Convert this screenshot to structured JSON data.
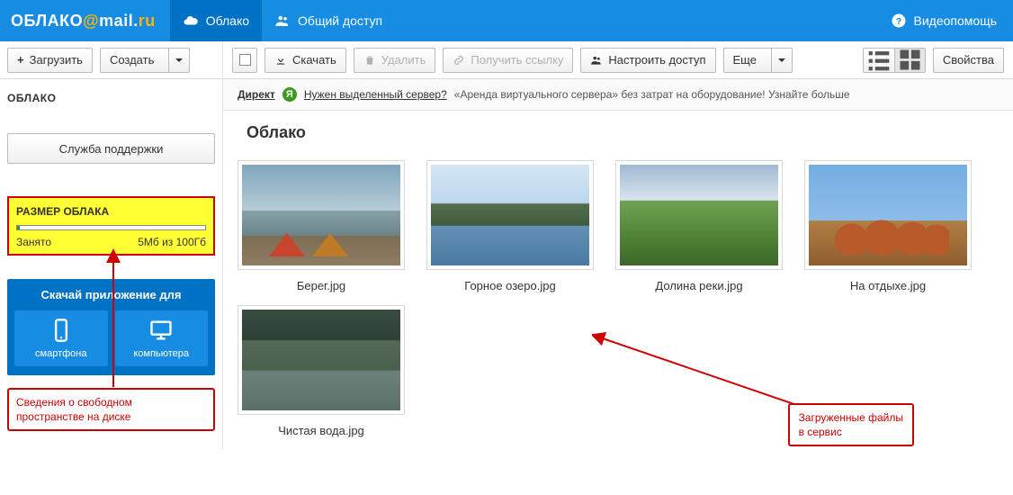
{
  "header": {
    "logo_text1": "ОБЛАКО",
    "logo_at": "@",
    "logo_text2": "mail",
    "logo_dot": ".",
    "logo_text3": "ru",
    "tab_cloud": "Облако",
    "tab_share": "Общий доступ",
    "help": "Видеопомощь"
  },
  "toolbar_left": {
    "upload": "Загрузить",
    "create": "Создать"
  },
  "toolbar_right": {
    "download": "Скачать",
    "delete": "Удалить",
    "get_link": "Получить ссылку",
    "set_access": "Настроить доступ",
    "more": "Еще",
    "properties": "Свойства"
  },
  "sidebar": {
    "title": "ОБЛАКО",
    "support": "Служба поддержки",
    "storage": {
      "title": "РАЗМЕР ОБЛАКА",
      "used_label": "Занято",
      "used_value": "5Мб из 100Гб"
    },
    "promo": {
      "title": "Скачай приложение для",
      "smartphone": "смартфона",
      "computer": "компьютера"
    }
  },
  "adbar": {
    "direkt": "Директ",
    "link": "Нужен выделенный сервер?",
    "text": "«Аренда виртуального сервера» без затрат на оборудование! Узнайте больше"
  },
  "content": {
    "title": "Облако"
  },
  "files": [
    {
      "name": "Берег.jpg",
      "cls": "photo1"
    },
    {
      "name": "Горное озеро.jpg",
      "cls": "photo2"
    },
    {
      "name": "Долина реки.jpg",
      "cls": "photo3"
    },
    {
      "name": "На отдыхе.jpg",
      "cls": "photo4"
    },
    {
      "name": "Чистая вода.jpg",
      "cls": "photo5"
    }
  ],
  "annotations": {
    "a1_l1": "Сведения о свободном",
    "a1_l2": "пространстве на диске",
    "a2_l1": "Загруженные файлы",
    "a2_l2": "в сервис"
  }
}
